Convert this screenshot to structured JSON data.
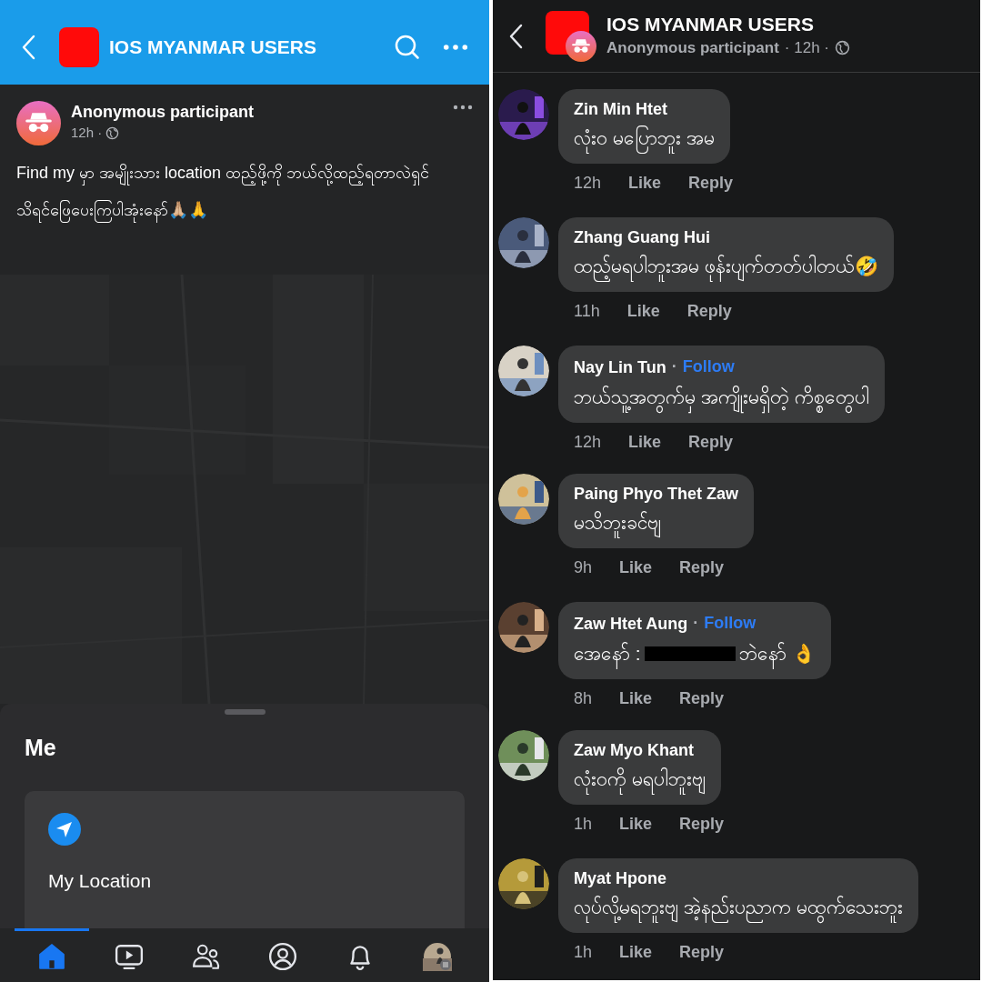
{
  "left_screen": {
    "header": {
      "title": "IOS MYANMAR USERS"
    },
    "post": {
      "author": "Anonymous participant",
      "time": "12h ·",
      "paragraphs": [
        "Find my မှာ အမျိုးသား location ထည့်ဖို့ကို ဘယ်လို့ထည့်ရတာလဲရှင်",
        "သိရင်ဖြေပေးကြပါအုံးနော်🙏🏼🙏"
      ]
    },
    "sheet": {
      "title": "Me",
      "location_label": "My Location"
    },
    "tab_bar": [
      {
        "kind": "home",
        "selected": true
      },
      {
        "kind": "video",
        "selected": false
      },
      {
        "kind": "friends",
        "selected": false
      },
      {
        "kind": "profile",
        "selected": false
      },
      {
        "kind": "notifications",
        "selected": false
      },
      {
        "kind": "menu",
        "selected": false
      }
    ]
  },
  "right_screen": {
    "header": {
      "title": "IOS MYANMAR USERS",
      "author": "Anonymous participant",
      "time": "· 12h ·"
    },
    "comments": [
      {
        "name": "Zin Min Htet",
        "segments": [
          {
            "kind": "text",
            "text": "လုံး၀ မပြောဘူး အမ"
          }
        ],
        "time": "12h",
        "like": "Like",
        "reply": "Reply"
      },
      {
        "name": "Zhang Guang Hui",
        "segments": [
          {
            "kind": "text",
            "text": "ထည့်မရပါဘူးအမ ဖုန်းပျက်တတ်ပါတယ်🤣"
          }
        ],
        "time": "11h",
        "like": "Like",
        "reply": "Reply"
      },
      {
        "name": "Nay Lin Tun",
        "separator": "·",
        "follow": "Follow",
        "segments": [
          {
            "kind": "text",
            "text": "ဘယ်သူ့အတွက်မှ အကျိုးမရှိတဲ့ ကိစ္စတွေပါ"
          }
        ],
        "time": "12h",
        "like": "Like",
        "reply": "Reply"
      },
      {
        "name": "Paing Phyo Thet Zaw",
        "segments": [
          {
            "kind": "text",
            "text": "မသိဘူးခင်ဗျ"
          }
        ],
        "time": "9h",
        "like": "Like",
        "reply": "Reply"
      },
      {
        "name": "Zaw Htet Aung",
        "separator": "·",
        "follow": "Follow",
        "segments": [
          {
            "kind": "text",
            "text": "အေနော် :"
          },
          {
            "kind": "redaction"
          },
          {
            "kind": "text",
            "text": "ဘဲနော် 👌"
          }
        ],
        "time": "8h",
        "like": "Like",
        "reply": "Reply"
      },
      {
        "name": "Zaw Myo Khant",
        "segments": [
          {
            "kind": "text",
            "text": "လုံး၀ကို မရပါဘူးဗျ"
          }
        ],
        "time": "1h",
        "like": "Like",
        "reply": "Reply"
      },
      {
        "name": "Myat Hpone",
        "segments": [
          {
            "kind": "text",
            "text": "လုပ်လို့မရဘူးဗျ အဲ့နည်းပညာက မထွက်သေးဘူး"
          }
        ],
        "time": "1h",
        "like": "Like",
        "reply": "Reply"
      }
    ]
  }
}
